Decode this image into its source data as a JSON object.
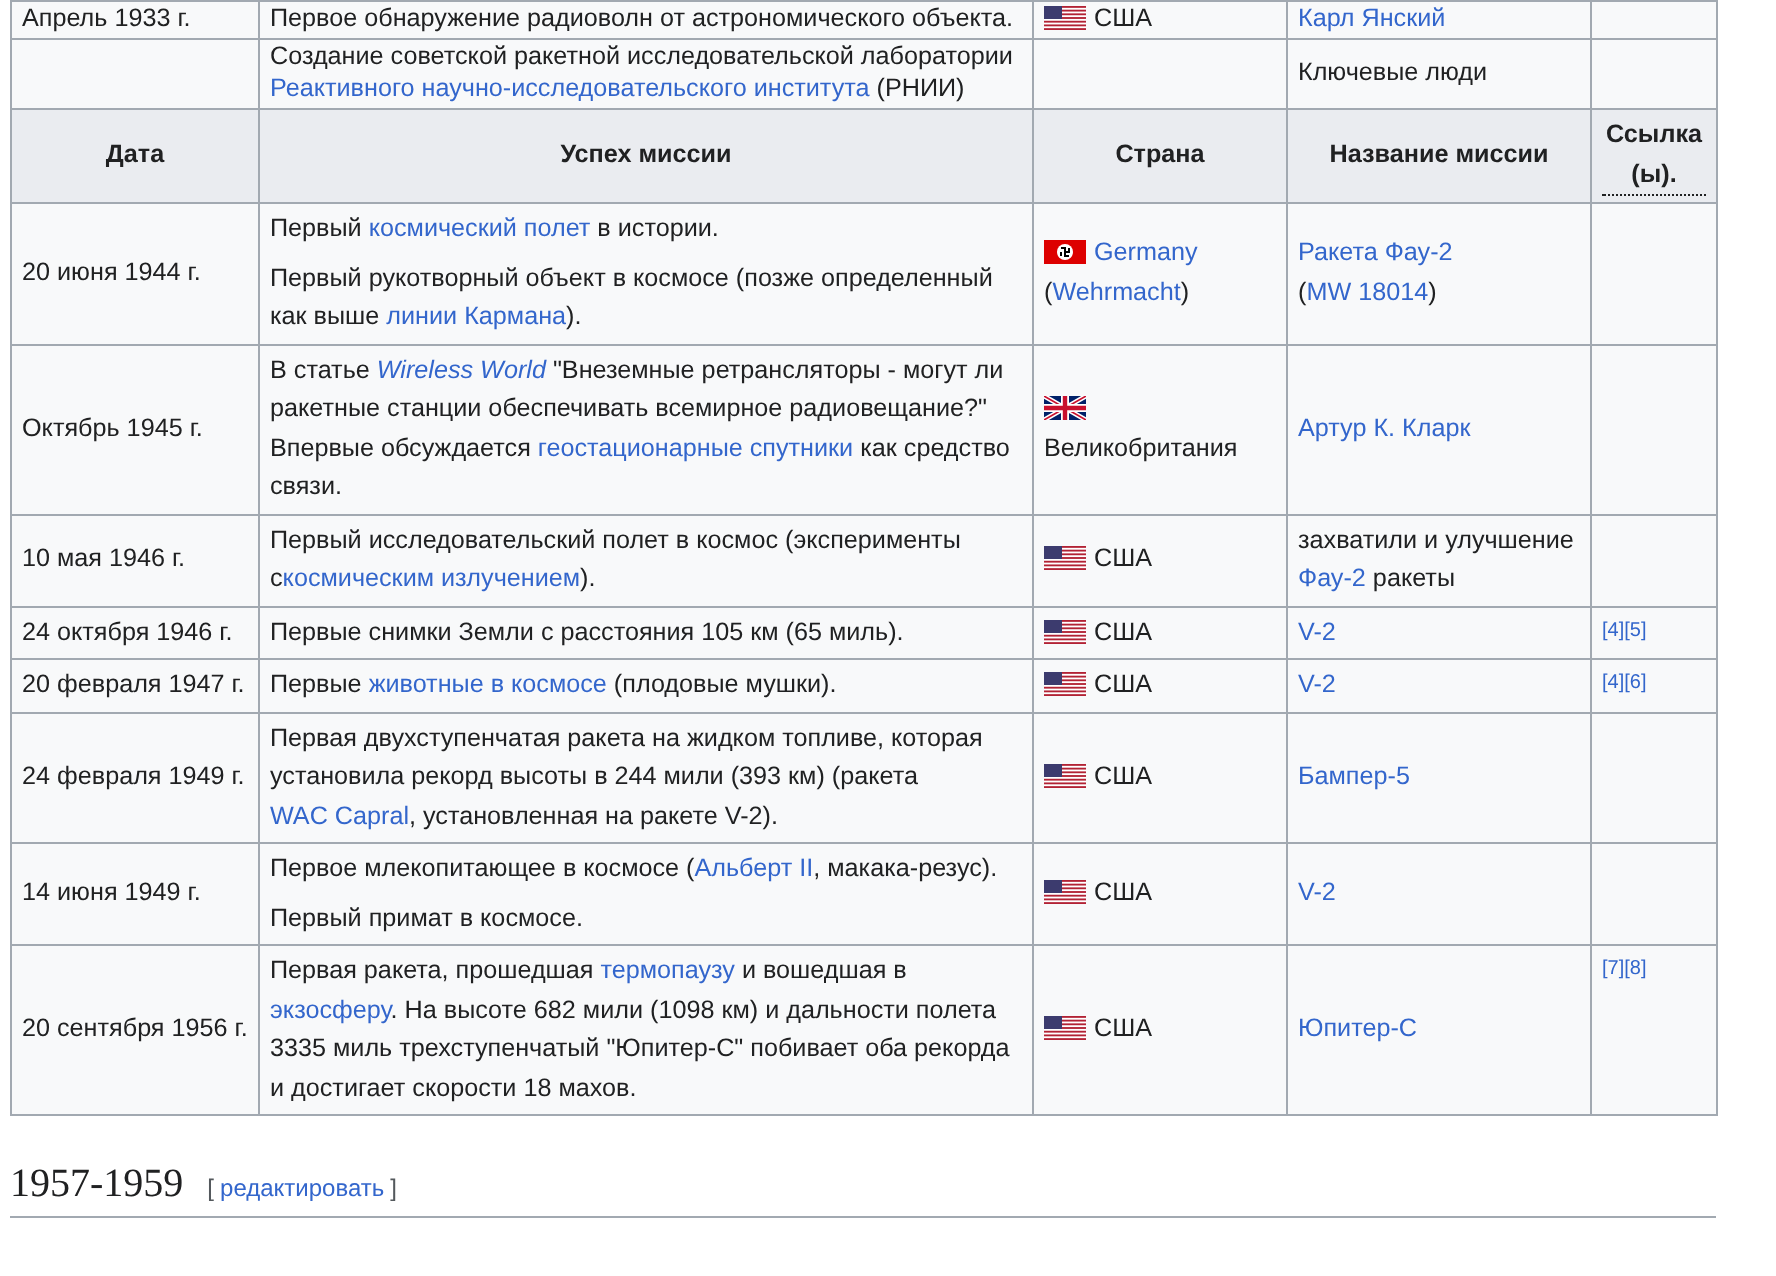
{
  "columns": [
    "Дата",
    "Успех миссии",
    "Страна",
    "Название миссии",
    "Ссылка (ы)."
  ],
  "top_rows": [
    {
      "date": "Апрель 1933 г.",
      "mission": [
        [
          {
            "text": "Первое обнаружение радиоволн от астрономического объекта."
          }
        ]
      ],
      "country": {
        "kind": "us",
        "name": [
          {
            "text": "США"
          }
        ]
      },
      "mission_name": [
        {
          "text": "Карл Янский",
          "link": true
        }
      ],
      "refs": []
    },
    {
      "mission": [
        [
          {
            "text": "Создание советской ракетной исследовательской лаборатории "
          },
          {
            "text": "Реактивного научно-исследовательского института",
            "link": true
          },
          {
            "text": " (РНИИ)"
          }
        ]
      ],
      "mission_name": [
        {
          "text": "Ключевые люди"
        }
      ],
      "refs": []
    }
  ],
  "rows": [
    {
      "date": "20 июня 1944 г.",
      "mission": [
        [
          {
            "text": "Первый "
          },
          {
            "text": "космический полет",
            "link": true
          },
          {
            "text": " в истории."
          }
        ],
        [
          {
            "text": "Первый рукотворный объект в космосе (позже определенный как выше "
          },
          {
            "text": "линии Кармана",
            "link": true
          },
          {
            "text": ")."
          }
        ]
      ],
      "country": {
        "kind": "de",
        "name": [
          {
            "text": "Germany",
            "link": true
          },
          {
            "text": " ("
          },
          {
            "text": "Wehrmacht",
            "link": true
          },
          {
            "text": ")"
          }
        ]
      },
      "mission_name": [
        {
          "text": "Ракета Фау-2",
          "link": true
        },
        {
          "text": " ("
        },
        {
          "text": "MW 18014",
          "link": true
        },
        {
          "text": ")"
        }
      ],
      "refs": []
    },
    {
      "date": "Октябрь 1945 г.",
      "mission": [
        [
          {
            "text": "В статье "
          },
          {
            "text": "Wireless World",
            "link": true,
            "italic": true
          },
          {
            "text": " \"Внеземные ретрансляторы - могут ли ракетные станции обеспечивать всемирное радиовещание?\" Впервые обсуждается "
          },
          {
            "text": "геостационарные спутники",
            "link": true
          },
          {
            "text": " как средство связи."
          }
        ]
      ],
      "country": {
        "kind": "uk",
        "name": [
          {
            "text": "Великобритания"
          }
        ]
      },
      "mission_name": [
        {
          "text": "Артур К. Кларк",
          "link": true
        }
      ],
      "refs": []
    },
    {
      "date": "10 мая 1946 г.",
      "mission": [
        [
          {
            "text": "Первый исследовательский полет в космос (эксперименты с"
          },
          {
            "text": "космическим излучением",
            "link": true
          },
          {
            "text": ")."
          }
        ]
      ],
      "country": {
        "kind": "us",
        "name": [
          {
            "text": "США"
          }
        ]
      },
      "mission_name": [
        {
          "text": "захватили и улучшение "
        },
        {
          "text": "Фау-2",
          "link": true
        },
        {
          "text": " ракеты"
        }
      ],
      "refs": []
    },
    {
      "date": "24 октября 1946 г.",
      "mission": [
        [
          {
            "text": "Первые снимки Земли с расстояния 105 км (65 миль)."
          }
        ]
      ],
      "country": {
        "kind": "us",
        "name": [
          {
            "text": "США"
          }
        ]
      },
      "mission_name": [
        {
          "text": "V-2",
          "link": true
        }
      ],
      "refs": [
        "[4]",
        "[5]"
      ]
    },
    {
      "date": "20 февраля 1947 г.",
      "mission": [
        [
          {
            "text": "Первые "
          },
          {
            "text": "животные в космосе",
            "link": true
          },
          {
            "text": " (плодовые мушки)."
          }
        ]
      ],
      "country": {
        "kind": "us",
        "name": [
          {
            "text": "США"
          }
        ]
      },
      "mission_name": [
        {
          "text": "V-2",
          "link": true
        }
      ],
      "refs": [
        "[4]",
        "[6]"
      ]
    },
    {
      "date": "24 февраля 1949 г.",
      "mission": [
        [
          {
            "text": "Первая двухступенчатая ракета на жидком топливе, которая установила рекорд высоты в 244 мили (393 км) (ракета "
          },
          {
            "text": "WAC Capral",
            "link": true
          },
          {
            "text": ", установленная на ракете V-2)."
          }
        ]
      ],
      "country": {
        "kind": "us",
        "name": [
          {
            "text": "США"
          }
        ]
      },
      "mission_name": [
        {
          "text": "Бампер-5",
          "link": true
        }
      ],
      "refs": []
    },
    {
      "date": "14 июня 1949 г.",
      "mission": [
        [
          {
            "text": "Первое млекопитающее в космосе ("
          },
          {
            "text": "Альберт II",
            "link": true
          },
          {
            "text": ", макака-резус)."
          }
        ],
        [
          {
            "text": "Первый примат в космосе."
          }
        ]
      ],
      "country": {
        "kind": "us",
        "name": [
          {
            "text": "США"
          }
        ]
      },
      "mission_name": [
        {
          "text": "V-2",
          "link": true
        }
      ],
      "refs": []
    },
    {
      "date": "20 сентября 1956 г.",
      "mission": [
        [
          {
            "text": "Первая ракета, прошедшая "
          },
          {
            "text": "термопаузу",
            "link": true
          },
          {
            "text": " и вошедшая в "
          },
          {
            "text": "экзосферу",
            "link": true
          },
          {
            "text": ". На высоте 682 мили (1098 км) и дальности полета 3335 миль трехступенчатый \"Юпитер-С\" побивает оба рекорда и достигает скорости 18 махов."
          }
        ]
      ],
      "country": {
        "kind": "us",
        "name": [
          {
            "text": "США"
          }
        ]
      },
      "mission_name": [
        {
          "text": "Юпитер-С",
          "link": true
        }
      ],
      "refs": [
        "[7]",
        "[8]"
      ]
    }
  ],
  "section": {
    "title": "1957-1959",
    "edit_open": "[",
    "edit_link": "редактировать",
    "edit_close": "]"
  }
}
